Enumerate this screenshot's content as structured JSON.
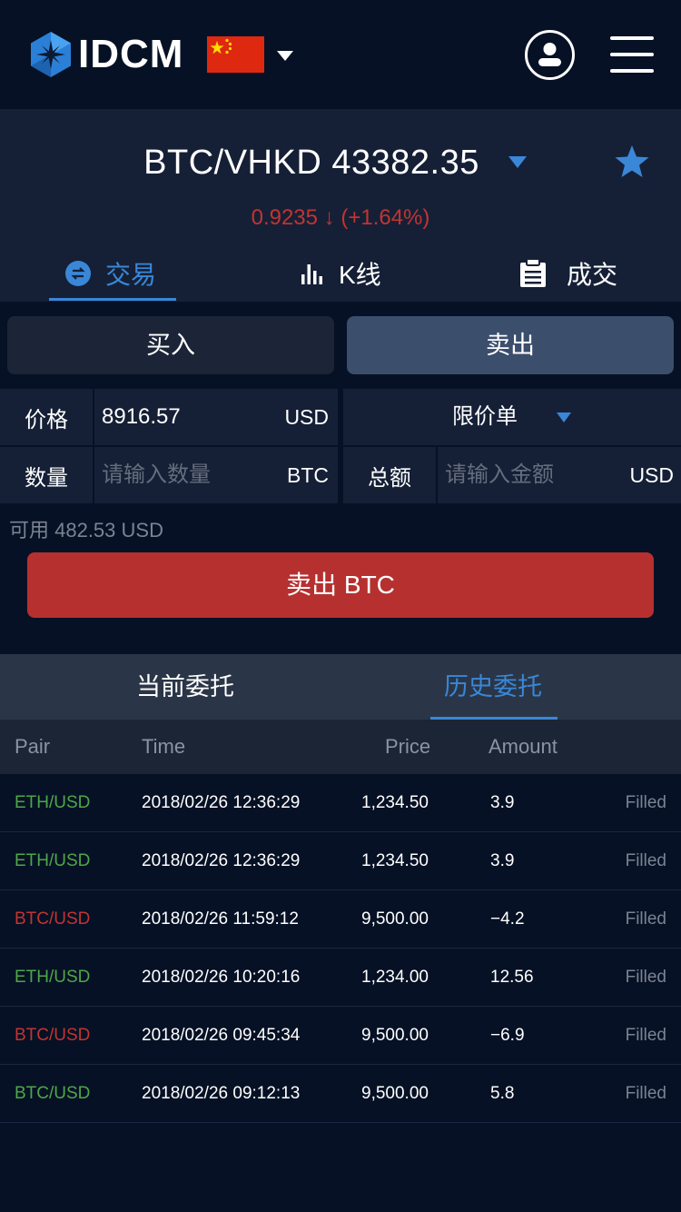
{
  "header": {
    "logo_text": "IDCM"
  },
  "ticker": {
    "pair": "BTC/VHKD 43382.35",
    "change": "0.9235 ↓ (+1.64%)"
  },
  "tabs": [
    {
      "label": "交易",
      "active": true
    },
    {
      "label": "K线",
      "active": false
    },
    {
      "label": "成交",
      "active": false
    }
  ],
  "trade": {
    "buy_label": "买入",
    "sell_label": "卖出",
    "price_label": "价格",
    "price_value": "8916.57",
    "price_unit": "USD",
    "order_type": "限价单",
    "qty_label": "数量",
    "qty_placeholder": "请输入数量",
    "qty_unit": "BTC",
    "total_label": "总额",
    "total_placeholder": "请输入金额",
    "total_unit": "USD",
    "available": "可用 482.53 USD",
    "submit_label": "卖出 BTC"
  },
  "orders": {
    "tabs": [
      "当前委托",
      "历史委托"
    ],
    "active_tab": 1,
    "columns": [
      "Pair",
      "Time",
      "Price",
      "Amount"
    ],
    "rows": [
      {
        "pair": "ETH/USD",
        "time": "2018/02/26 12:36:29",
        "price": "1,234.50",
        "amount": "3.9",
        "status": "Filled",
        "color": "green"
      },
      {
        "pair": "ETH/USD",
        "time": "2018/02/26 12:36:29",
        "price": "1,234.50",
        "amount": "3.9",
        "status": "Filled",
        "color": "green"
      },
      {
        "pair": "BTC/USD",
        "time": "2018/02/26 11:59:12",
        "price": "9,500.00",
        "amount": "−4.2",
        "status": "Filled",
        "color": "red"
      },
      {
        "pair": "ETH/USD",
        "time": "2018/02/26 10:20:16",
        "price": "1,234.00",
        "amount": "12.56",
        "status": "Filled",
        "color": "green"
      },
      {
        "pair": "BTC/USD",
        "time": "2018/02/26 09:45:34",
        "price": "9,500.00",
        "amount": "−6.9",
        "status": "Filled",
        "color": "red"
      },
      {
        "pair": "BTC/USD",
        "time": "2018/02/26 09:12:13",
        "price": "9,500.00",
        "amount": "5.8",
        "status": "Filled",
        "color": "green"
      }
    ]
  },
  "colors": {
    "accent": "#3a87d8",
    "down": "#c23431",
    "up": "#4ea748",
    "sell_button": "#b73030"
  }
}
